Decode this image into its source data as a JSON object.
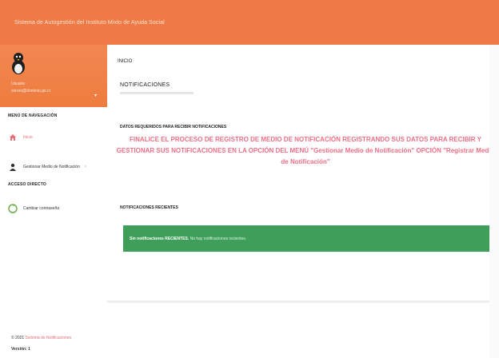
{
  "header": {
    "title": "Sistema de Autogestión del Instituto Mixto de Ayuda Social"
  },
  "user": {
    "name": "Usuario",
    "email": "correo@dominio.go.cr"
  },
  "sidebar": {
    "nav_header": "MENÚ DE NAVEGACIÓN",
    "items": [
      {
        "label": "Inicio",
        "icon": "home-icon"
      },
      {
        "label": "Gestionar Medio de Notificación",
        "icon": "user-icon"
      }
    ],
    "direct_header": "ACCESO DIRECTO",
    "direct_items": [
      {
        "label": "Cambiar contraseña",
        "icon": "refresh-icon"
      }
    ],
    "footer_copy": "© 2021",
    "footer_link": "Sistema de Notificaciones",
    "footer_version": "Versión: 1"
  },
  "main": {
    "breadcrumb": "INICIO",
    "title": "NOTIFICACIONES",
    "section_required": "DATOS REQUERIDOS PARA RECIBIR NOTIFICACIONES",
    "alert_message": "FINALICE EL PROCESO DE REGISTRO DE MEDIO DE NOTIFICACIÓN REGISTRANDO SUS DATOS PARA RECIBIR Y GESTIONAR SUS NOTIFICACIONES EN LA OPCIÓN DEL MENÚ \"Gestionar Medio de Notificación\" OPCIÓN \"Registrar Medio de Notificación\"",
    "section_recent": "NOTIFICACIONES RECIENTES",
    "recent_strong": "Sin notificaciones RECIENTES.",
    "recent_text": "No hay notificaciones recientes."
  },
  "colors": {
    "header": "#f07a45",
    "alert_text": "#ee6f86",
    "success": "#3f9f5a"
  }
}
